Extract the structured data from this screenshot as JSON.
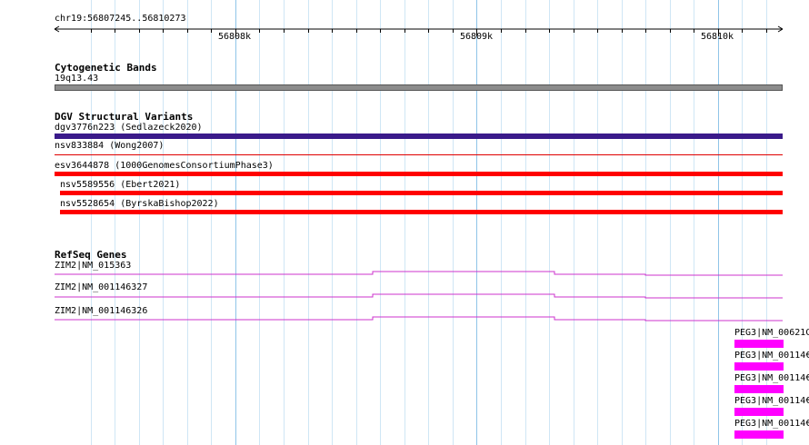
{
  "ruler": {
    "region": "chr19:56807245..56810273",
    "ticks": [
      "56808k",
      "56809k",
      "56810k"
    ]
  },
  "cytobands": {
    "title": "Cytogenetic Bands",
    "band_label": "19q13.43",
    "band_color": "#8c8c8c"
  },
  "dgv": {
    "title": "DGV Structural Variants",
    "items": [
      {
        "label": "dgv3776n223 (Sedlazeck2020)",
        "color": "#3a1a8a"
      },
      {
        "label": "nsv833884 (Wong2007)",
        "color": "#e00000"
      },
      {
        "label": "esv3644878 (1000GenomesConsortiumPhase3)",
        "color": "#ff0000"
      },
      {
        "label": "nsv5589556 (Ebert2021)",
        "color": "#ff0000"
      },
      {
        "label": "nsv5528654 (ByrskaBishop2022)",
        "color": "#ff0000"
      }
    ]
  },
  "refseq": {
    "title": "RefSeq Genes",
    "zim2": [
      {
        "label": "ZIM2|NM_015363"
      },
      {
        "label": "ZIM2|NM_001146327"
      },
      {
        "label": "ZIM2|NM_001146326"
      }
    ],
    "peg3": [
      {
        "label": "PEG3|NM_00621C"
      },
      {
        "label": "PEG3|NM_00114€"
      },
      {
        "label": "PEG3|NM_00114€"
      },
      {
        "label": "PEG3|NM_00114€"
      },
      {
        "label": "PEG3|NM_00114€"
      }
    ],
    "zim2_color": "#cc33cc",
    "peg3_color": "#ff00ff"
  },
  "colors": {
    "grid_major": "#8fc4e8",
    "grid_minor": "#cfe6f5"
  }
}
